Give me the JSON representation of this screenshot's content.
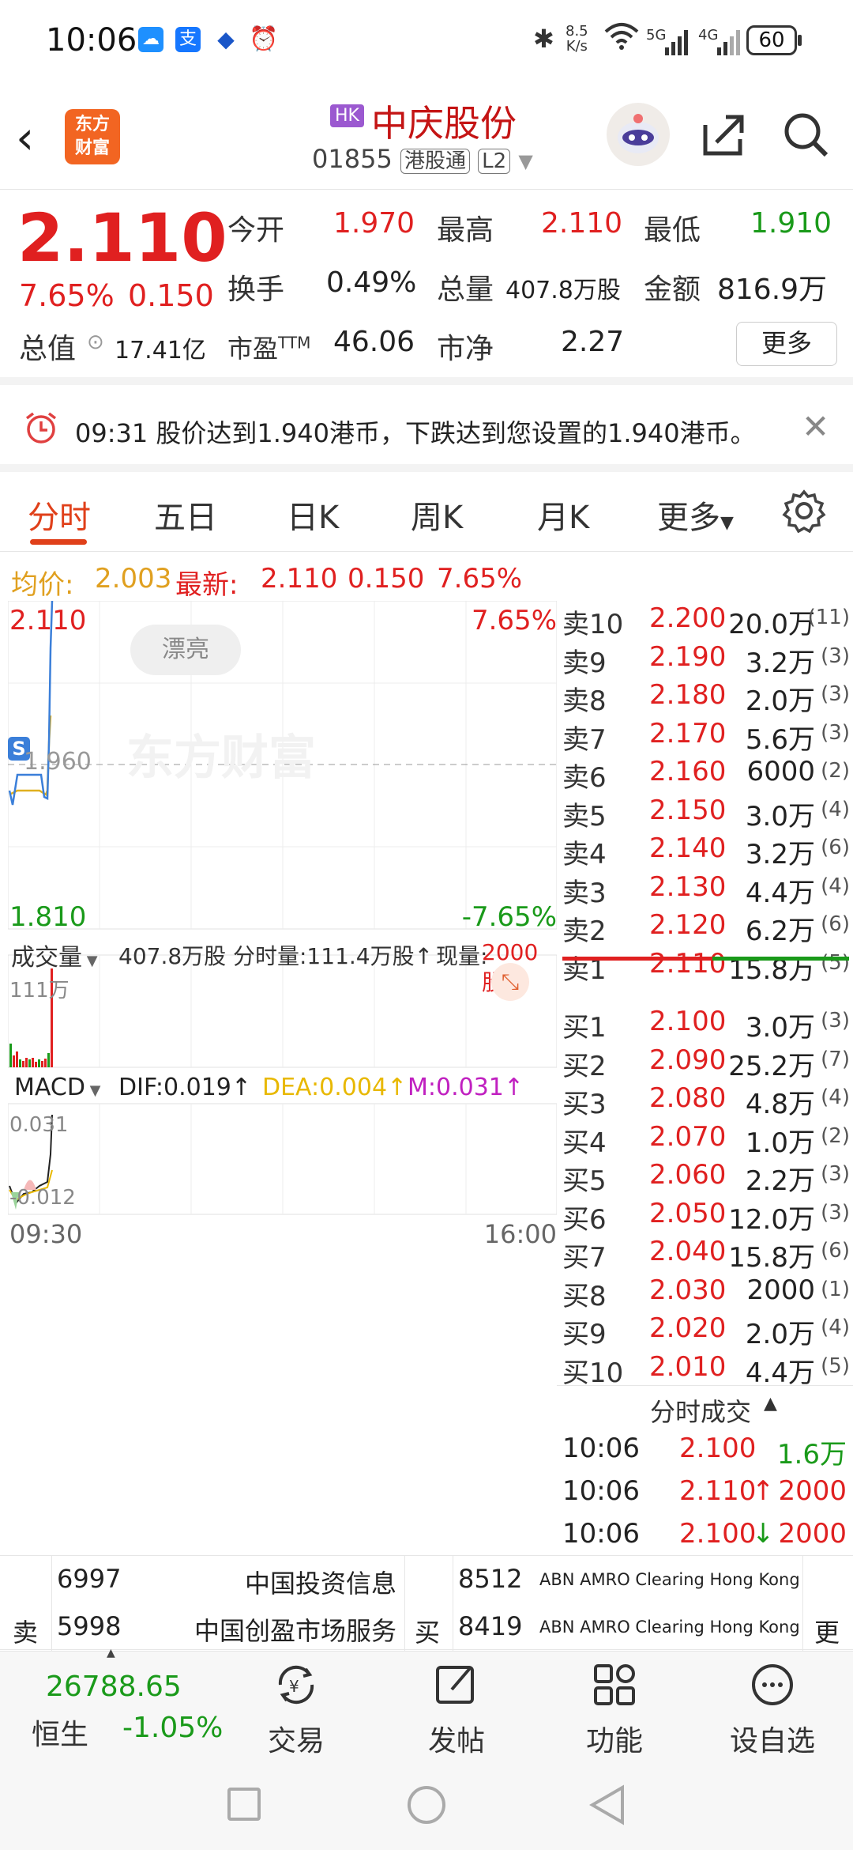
{
  "status_bar": {
    "time": "10:06",
    "net_speed_value": "8.5",
    "net_speed_unit": "K/s",
    "sig1": "5G",
    "sig2": "4G",
    "battery": "60"
  },
  "header": {
    "logo_line1": "东方",
    "logo_line2": "财富",
    "market_badge": "HK",
    "stock_name": "中庆股份",
    "stock_code": "01855",
    "tag_connect": "港股通",
    "tag_level": "L2"
  },
  "quote": {
    "price": "2.110",
    "change_pct": "7.65%",
    "change_amt": "0.150",
    "open_label": "今开",
    "open": "1.970",
    "high_label": "最高",
    "high": "2.110",
    "low_label": "最低",
    "low": "1.910",
    "turnover_label": "换手",
    "turnover": "0.49%",
    "volume_label": "总量",
    "volume": "407.8万股",
    "amount_label": "金额",
    "amount": "816.9万",
    "mcap_label": "总值",
    "mcap": "17.41亿",
    "pe_label": "市盈",
    "pe_sup": "TTM",
    "pe": "46.06",
    "pb_label": "市净",
    "pb": "2.27",
    "more_button": "更多"
  },
  "alert": {
    "text": "09:31 股价达到1.940港币，下跌达到您设置的1.940港币。"
  },
  "tabs": [
    "分时",
    "五日",
    "日K",
    "周K",
    "月K",
    "更多"
  ],
  "info_row": {
    "avg_label": "均价:",
    "avg": "2.003",
    "latest_label": "最新:",
    "latest": "2.110",
    "chg": "0.150",
    "chg_pct": "7.65%"
  },
  "chart": {
    "top_price": "2.110",
    "top_pct": "7.65%",
    "mid_price": "1.960",
    "bottom_price": "1.810",
    "bottom_pct": "-7.65%",
    "badge": "漂亮",
    "watermark": "东方财富",
    "volume_bar": {
      "label": "成交量",
      "total": "407.8万股",
      "period_vol": "分时量:111.4万股↑",
      "current_label": "现量:",
      "current": "2000股",
      "max": "111万"
    },
    "macd": {
      "label": "MACD",
      "dif": "DIF:0.019↑",
      "dea": "DEA:0.004↑",
      "m": "M:0.031↑",
      "top": "0.031",
      "bottom": "-0.012"
    },
    "time_start": "09:30",
    "time_end": "16:00",
    "colors": {
      "price_line": "#3b7fd9",
      "avg_line": "#e0b020",
      "up": "#e02020",
      "down": "#1a9a1a"
    }
  },
  "order_book": {
    "sell": [
      {
        "label": "卖10",
        "price": "2.200",
        "vol": "20.0万",
        "cnt": "(11)"
      },
      {
        "label": "卖9",
        "price": "2.190",
        "vol": "3.2万",
        "cnt": "(3)"
      },
      {
        "label": "卖8",
        "price": "2.180",
        "vol": "2.0万",
        "cnt": "(3)"
      },
      {
        "label": "卖7",
        "price": "2.170",
        "vol": "5.6万",
        "cnt": "(3)"
      },
      {
        "label": "卖6",
        "price": "2.160",
        "vol": "6000",
        "cnt": "(2)"
      },
      {
        "label": "卖5",
        "price": "2.150",
        "vol": "3.0万",
        "cnt": "(4)"
      },
      {
        "label": "卖4",
        "price": "2.140",
        "vol": "3.2万",
        "cnt": "(6)"
      },
      {
        "label": "卖3",
        "price": "2.130",
        "vol": "4.4万",
        "cnt": "(4)"
      },
      {
        "label": "卖2",
        "price": "2.120",
        "vol": "6.2万",
        "cnt": "(6)"
      },
      {
        "label": "卖1",
        "price": "2.110",
        "vol": "15.8万",
        "cnt": "(5)"
      }
    ],
    "buy": [
      {
        "label": "买1",
        "price": "2.100",
        "vol": "3.0万",
        "cnt": "(3)"
      },
      {
        "label": "买2",
        "price": "2.090",
        "vol": "25.2万",
        "cnt": "(7)"
      },
      {
        "label": "买3",
        "price": "2.080",
        "vol": "4.8万",
        "cnt": "(4)"
      },
      {
        "label": "买4",
        "price": "2.070",
        "vol": "1.0万",
        "cnt": "(2)"
      },
      {
        "label": "买5",
        "price": "2.060",
        "vol": "2.2万",
        "cnt": "(3)"
      },
      {
        "label": "买6",
        "price": "2.050",
        "vol": "12.0万",
        "cnt": "(3)"
      },
      {
        "label": "买7",
        "price": "2.040",
        "vol": "15.8万",
        "cnt": "(6)"
      },
      {
        "label": "买8",
        "price": "2.030",
        "vol": "2000",
        "cnt": "(1)"
      },
      {
        "label": "买9",
        "price": "2.020",
        "vol": "2.0万",
        "cnt": "(4)"
      },
      {
        "label": "买10",
        "price": "2.010",
        "vol": "4.4万",
        "cnt": "(5)"
      }
    ]
  },
  "ticks": {
    "title": "分时成交",
    "rows": [
      {
        "time": "10:06",
        "price": "2.100",
        "arrow": "",
        "vol": "1.6万",
        "vol_color": "green"
      },
      {
        "time": "10:06",
        "price": "2.110",
        "arrow": "↑",
        "vol": "2000",
        "vol_color": "red"
      },
      {
        "time": "10:06",
        "price": "2.100",
        "arrow": "↓",
        "vol": "2000",
        "vol_color": "red"
      }
    ]
  },
  "brokers": {
    "sell_label": "卖",
    "buy_label": "买",
    "more_label": "更",
    "sell": [
      {
        "id": "6997",
        "name": "中国投资信息"
      },
      {
        "id": "5998",
        "name": "中国创盈市场服务"
      }
    ],
    "buy": [
      {
        "id": "8512",
        "name": "ABN AMRO Clearing Hong Kong"
      },
      {
        "id": "8419",
        "name": "ABN AMRO Clearing Hong Kong"
      }
    ]
  },
  "bottom_nav": {
    "index_value": "26788.65",
    "index_name": "恒生",
    "index_change": "-1.05%",
    "trade": "交易",
    "post": "发帖",
    "function": "功能",
    "watchlist": "设自选"
  }
}
